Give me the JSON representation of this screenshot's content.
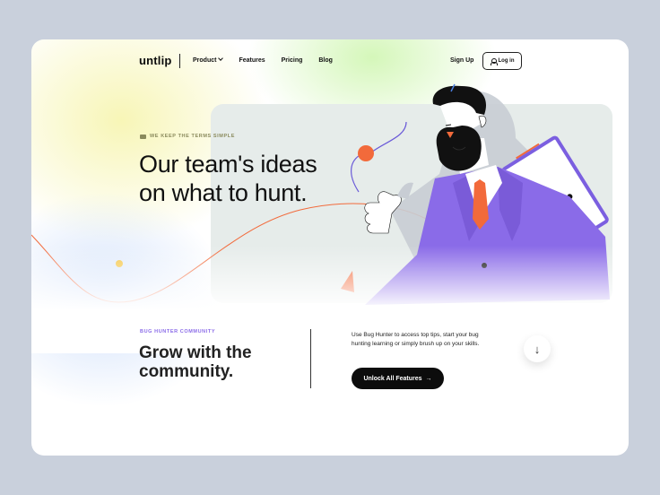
{
  "brand": {
    "logo": "untlip"
  },
  "nav": {
    "items": [
      {
        "label": "Product",
        "has_dropdown": true
      },
      {
        "label": "Features"
      },
      {
        "label": "Pricing"
      },
      {
        "label": "Blog"
      }
    ],
    "signup_label": "Sign Up",
    "login_label": "Log in"
  },
  "hero": {
    "eyebrow": "WE KEEP THE TERMS SIMPLE",
    "headline": "Our team's ideas on what to hunt."
  },
  "community": {
    "eyebrow": "BUG HUNTER COMMUNITY",
    "title": "Grow with the community.",
    "description": "Use Bug Hunter to access top tips, start your bug hunting learning or simply brush up on your skills.",
    "cta_label": "Unlock All Features",
    "cta_arrow": "→",
    "scroll_arrow": "↓"
  },
  "icons": {
    "eyebrow": "ticket-icon",
    "login": "user-icon",
    "scroll": "arrow-down-icon"
  },
  "colors": {
    "background": "#c9d0dc",
    "card": "#ffffff",
    "accent_purple": "#8a6be8",
    "accent_orange": "#f26a3b",
    "cta": "#0c0c0c"
  }
}
